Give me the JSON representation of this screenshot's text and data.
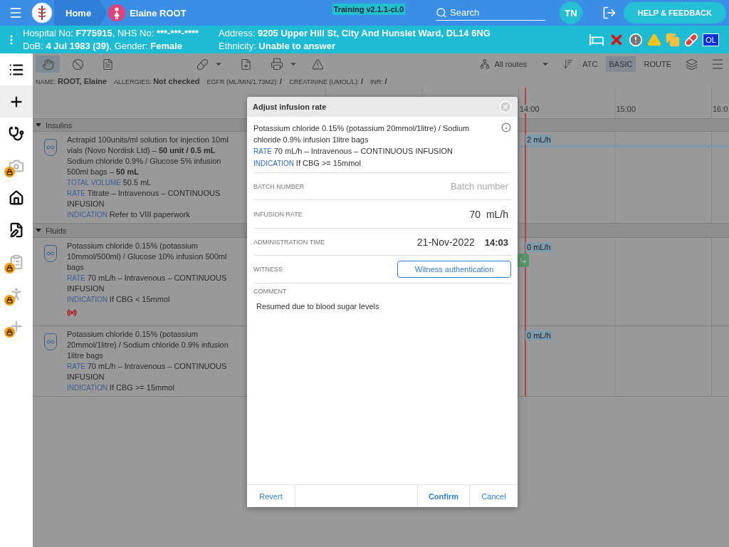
{
  "header": {
    "home": "Home",
    "patient_name": "Elaine ROOT",
    "environment": "Training v2.1.1-ci.0",
    "search": {
      "placeholder": "Search"
    },
    "user_initials": "TN",
    "help": "HELP & FEEDBACK"
  },
  "patient_bar": {
    "left_lines": [
      [
        {
          "label": "Hospital No: ",
          "value": "F775915"
        },
        {
          "label": ", NHS No: ",
          "value": "***-***-****"
        }
      ],
      [
        {
          "label": "DoB: ",
          "value": "4 Jul 1983 (39)"
        },
        {
          "label": ", Gender: ",
          "value": "Female"
        }
      ]
    ],
    "right_lines": [
      [
        {
          "label": "Address: ",
          "value": "9205 Upper Hill St, City And Hunslet Ward, DL14 6NG"
        }
      ],
      [
        {
          "label": "Ethnicity: ",
          "value": "Unable to answer"
        }
      ]
    ],
    "alerts": [
      {
        "kind": "bed"
      },
      {
        "kind": "cross"
      },
      {
        "kind": "exclamation"
      },
      {
        "kind": "warning"
      },
      {
        "kind": "copies"
      },
      {
        "kind": "pill"
      },
      {
        "kind": "badge",
        "text": "OL"
      }
    ]
  },
  "sidebar": [
    {
      "kind": "list",
      "selected": false,
      "locked": false
    },
    {
      "kind": "plus",
      "selected": true,
      "locked": false
    },
    {
      "kind": "stethoscope",
      "selected": false,
      "locked": false
    },
    {
      "kind": "camera",
      "selected": false,
      "locked": true
    },
    {
      "kind": "home",
      "selected": false,
      "locked": false
    },
    {
      "kind": "sign",
      "selected": false,
      "locked": false
    },
    {
      "kind": "clipboard",
      "selected": false,
      "locked": true
    },
    {
      "kind": "walk",
      "selected": false,
      "locked": true
    },
    {
      "kind": "plus",
      "selected": false,
      "locked": true
    }
  ],
  "toolbar": {
    "views": [
      {
        "selected": true
      },
      {
        "selected": false
      },
      {
        "selected": false
      }
    ],
    "routes": "All routes",
    "modes": [
      {
        "label": "ATC",
        "selected": false
      },
      {
        "label": "BASIC",
        "selected": true
      },
      {
        "label": "ROUTE",
        "selected": false
      }
    ]
  },
  "info": [
    {
      "label": "NAME:",
      "value": "ROOT, Elaine"
    },
    {
      "label": "ALLERGIES:",
      "value": "Not checked"
    },
    {
      "label": "EGFR (ML/MIN/1.73M2):",
      "value": "/"
    },
    {
      "label": "CREATININE (UMOL/L):",
      "value": "/"
    },
    {
      "label": "INR:",
      "value": "/"
    }
  ],
  "timeline": {
    "hours": [
      "14:00",
      "15:00",
      "16:0"
    ]
  },
  "groups": [
    {
      "name": "Insulins",
      "expanded": true,
      "items": [
        {
          "lines": [
            {
              "text": "Actrapid 100units/ml solution for injection 10ml vials (Novo Nordisk Ltd) – **50 unit / 0.5 mL**"
            },
            {
              "text": "Sodium chloride 0.9% / Glucose 5% infusion 500ml bags – **50 mL**"
            },
            {
              "label": "TOTAL VOLUME",
              "text": "50.5 mL"
            },
            {
              "label": "RATE",
              "text": "Titrate – Intravenous – CONTINUOUS INFUSION"
            },
            {
              "label": "INDICATION",
              "text": "Refer to VIII paperwork"
            }
          ],
          "alert": false,
          "rate_tag": "2 mL/h",
          "running": true,
          "event": false
        }
      ]
    },
    {
      "name": "Fluids",
      "expanded": true,
      "items": [
        {
          "lines": [
            {
              "text": "Potassium chloride 0.15% (potassium 10mmol/500ml) / Glucose 10% infusion 500ml bags"
            },
            {
              "label": "RATE",
              "text": "70 mL/h – Intravenous – CONTINUOUS INFUSION"
            },
            {
              "label": "INDICATION",
              "text": "If CBG < 15mmol"
            }
          ],
          "alert": true,
          "rate_tag": "0 mL/h",
          "running": false,
          "event": true
        },
        {
          "lines": [
            {
              "text": "Potassium chloride 0.15% (potassium 20mmol/1litre) / Sodium chloride 0.9% infusion 1litre bags"
            },
            {
              "label": "RATE",
              "text": "70 mL/h – Intravenous – CONTINUOUS INFUSION"
            },
            {
              "label": "INDICATION",
              "text": "If CBG >= 15mmol"
            }
          ],
          "alert": false,
          "rate_tag": "0 mL/h",
          "running": false,
          "event": false
        }
      ]
    }
  ],
  "dialog": {
    "title": "Adjust infusion rate",
    "drug": "Potassium chloride 0.15% (potassium 20mmol/1litre) / Sodium chloride 0.9% infusion 1litre bags",
    "details": [
      {
        "label": "RATE",
        "text": "70 mL/h – Intravenous – CONTINUOUS INFUSION"
      },
      {
        "label": "INDICATION",
        "text": "If CBG >= 15mmol"
      }
    ],
    "batch": {
      "label": "BATCH NUMBER",
      "placeholder": "Batch number"
    },
    "rate": {
      "label": "INFUSION RATE",
      "value": "70",
      "unit": "mL/h"
    },
    "time": {
      "label": "ADMINISTRATION TIME",
      "date": "21-Nov-2022",
      "time": "14:03"
    },
    "witness": {
      "label": "WITNESS",
      "button": "Witness authentication"
    },
    "comment": {
      "label": "COMMENT",
      "value": "Resumed due to blood sugar levels"
    },
    "buttons": {
      "revert": "Revert",
      "confirm": "Confirm",
      "cancel": "Cancel"
    }
  }
}
